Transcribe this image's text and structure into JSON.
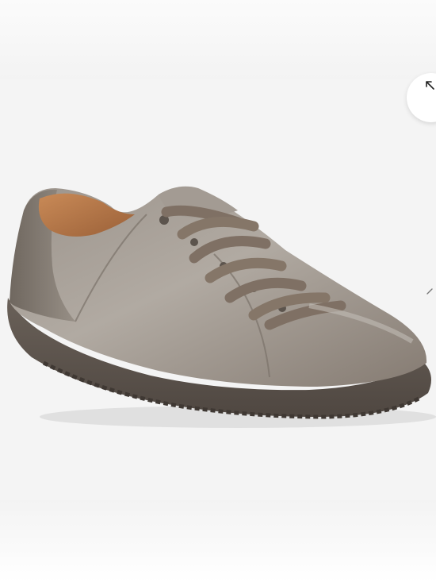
{
  "product": {
    "image_alt": "",
    "colors": {
      "upper": "#8e857c",
      "upper_highlight": "#b3aca4",
      "sole": "#5e554e",
      "lining": "#b87a4c",
      "laces": "#7f7064"
    }
  },
  "controls": {
    "expand_icon": "expand-arrow-icon",
    "next_icon": "chevron-right-icon"
  }
}
